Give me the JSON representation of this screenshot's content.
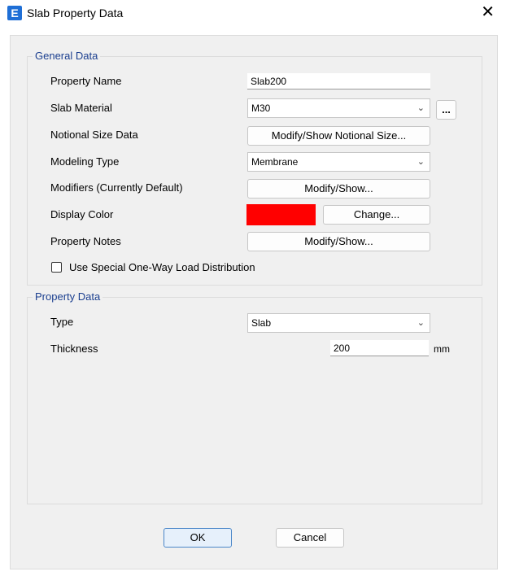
{
  "window": {
    "title": "Slab Property Data",
    "app_icon_letter": "E",
    "close_glyph": "✕"
  },
  "general": {
    "title": "General Data",
    "property_name_label": "Property Name",
    "property_name_value": "Slab200",
    "slab_material_label": "Slab Material",
    "slab_material_value": "M30",
    "material_more_button": "...",
    "notional_label": "Notional Size Data",
    "notional_button": "Modify/Show Notional Size...",
    "modeling_type_label": "Modeling Type",
    "modeling_type_value": "Membrane",
    "modifiers_label": "Modifiers (Currently Default)",
    "modifiers_button": "Modify/Show...",
    "display_color_label": "Display Color",
    "display_color": "#ff0000",
    "change_button": "Change...",
    "notes_label": "Property Notes",
    "notes_button": "Modify/Show...",
    "one_way_checkbox_label": "Use Special One-Way Load Distribution",
    "one_way_checked": false
  },
  "property": {
    "title": "Property Data",
    "type_label": "Type",
    "type_value": "Slab",
    "thickness_label": "Thickness",
    "thickness_value": "200",
    "thickness_unit": "mm"
  },
  "footer": {
    "ok_button": "OK",
    "cancel_button": "Cancel"
  }
}
